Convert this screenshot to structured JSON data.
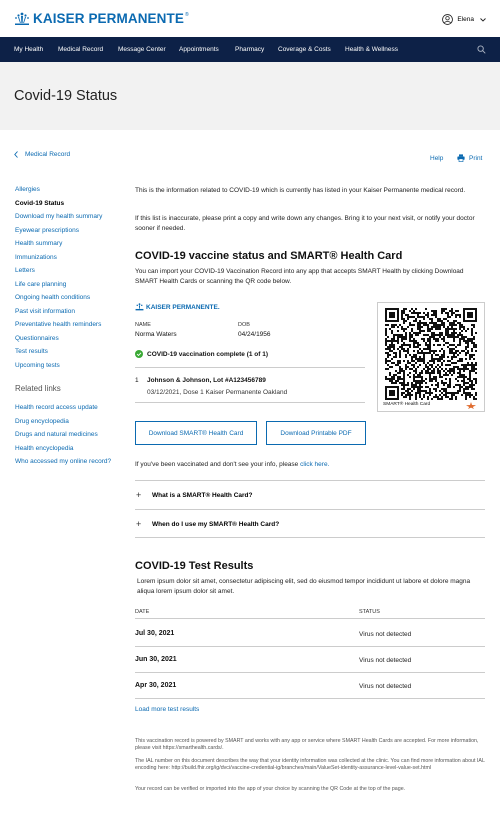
{
  "brand": {
    "name": "KAISER PERMANENTE",
    "tm": "®"
  },
  "user": {
    "name": "Elena"
  },
  "nav": {
    "items": [
      "My Health",
      "Medical Record",
      "Message Center",
      "Appointments",
      "Pharmacy",
      "Coverage & Costs",
      "Health & Wellness"
    ]
  },
  "page": {
    "title": "Covid-19 Status"
  },
  "breadcrumb": {
    "label": "Medical Record"
  },
  "tools": {
    "help": "Help",
    "print": "Print"
  },
  "sidebar": {
    "items": [
      "Allergies",
      "Covid-19 Status",
      "Download my health summary",
      "Eyewear prescriptions",
      "Health summary",
      "Immunizations",
      "Letters",
      "Life care planning",
      "Ongoing health conditions",
      "Past visit information",
      "Preventative health reminders",
      "Questionnaires",
      "Test results",
      "Upcoming tests"
    ],
    "related_heading": "Related links",
    "related": [
      "Health record access update",
      "Drug encyclopedia",
      "Drugs and natural medicines",
      "Health encyclopedia",
      "Who accessed my online record?"
    ]
  },
  "intro": {
    "p1": "This is the information related to COVID-19 which is currently has listed in your Kaiser Permanente medical record.",
    "p2": "If this list is inaccurate, please print a copy and write down any changes. Bring it to your next visit, or notify your doctor sooner if needed."
  },
  "vaccine": {
    "heading": "COVID-19 vaccine status and SMART® Health Card",
    "description": "You can import your COVID-19 Vaccination Record into any app that accepts SMART Health by clicking Download SMART Health Cards or scanning the QR code below.",
    "card_logo": "KAISER PERMANENTE.",
    "name_label": "NAME",
    "name_value": "Norma Waters",
    "dob_label": "DOB",
    "dob_value": "04/24/1956",
    "status": "COVID-19 vaccination complete (1 of 1)",
    "dose_number": "1",
    "dose_title": "Johnson & Johnson, Lot #A123456789",
    "dose_detail": "03/12/2021, Dose 1 Kaiser Permanente Oakland",
    "qr_caption": "SMART® Health Card",
    "btn_card": "Download SMART® Health Card",
    "btn_pdf": "Download Printable PDF",
    "missing_text": "If you've been vaccinated and don't see your info, please",
    "missing_link": "click here."
  },
  "faq": [
    "What is a SMART® Health Card?",
    "When do I use my SMART® Health Card?"
  ],
  "tests": {
    "heading": "COVID-19 Test Results",
    "description": "Lorem ipsum dolor sit amet, consectetur adipiscing elit, sed do eiusmod tempor incididunt ut labore et dolore magna aliqua lorem ipsum dolor sit amet.",
    "col_date": "DATE",
    "col_status": "STATUS",
    "rows": [
      {
        "date": "Jul 30, 2021",
        "status": "Virus not detected"
      },
      {
        "date": "Jun 30, 2021",
        "status": "Virus not detected"
      },
      {
        "date": "Apr 30, 2021",
        "status": "Virus not detected"
      }
    ],
    "load_more": "Load more test results"
  },
  "footer": {
    "p1": "This vaccination record is powered by SMART and works with any app or service where SMART Health Cards are accepted. For more information, please visit https://smarthealth.cards/.",
    "p2": "The IAL number on this document describes the way that your identity information was collected at the clinic. You can find more information about IAL encoding here: http://build.fhir.org/ig/dvci/vaccine-credential-ig/branches/main/ValueSet-identity-assurance-level-value-set.html",
    "p3": "Your record can be verified or imported into the app of your choice by scanning the QR Code at the top of the page."
  },
  "colors": {
    "brand_blue": "#0b6ab1",
    "nav_bg": "#0d2147",
    "success_green": "#3aa935"
  }
}
